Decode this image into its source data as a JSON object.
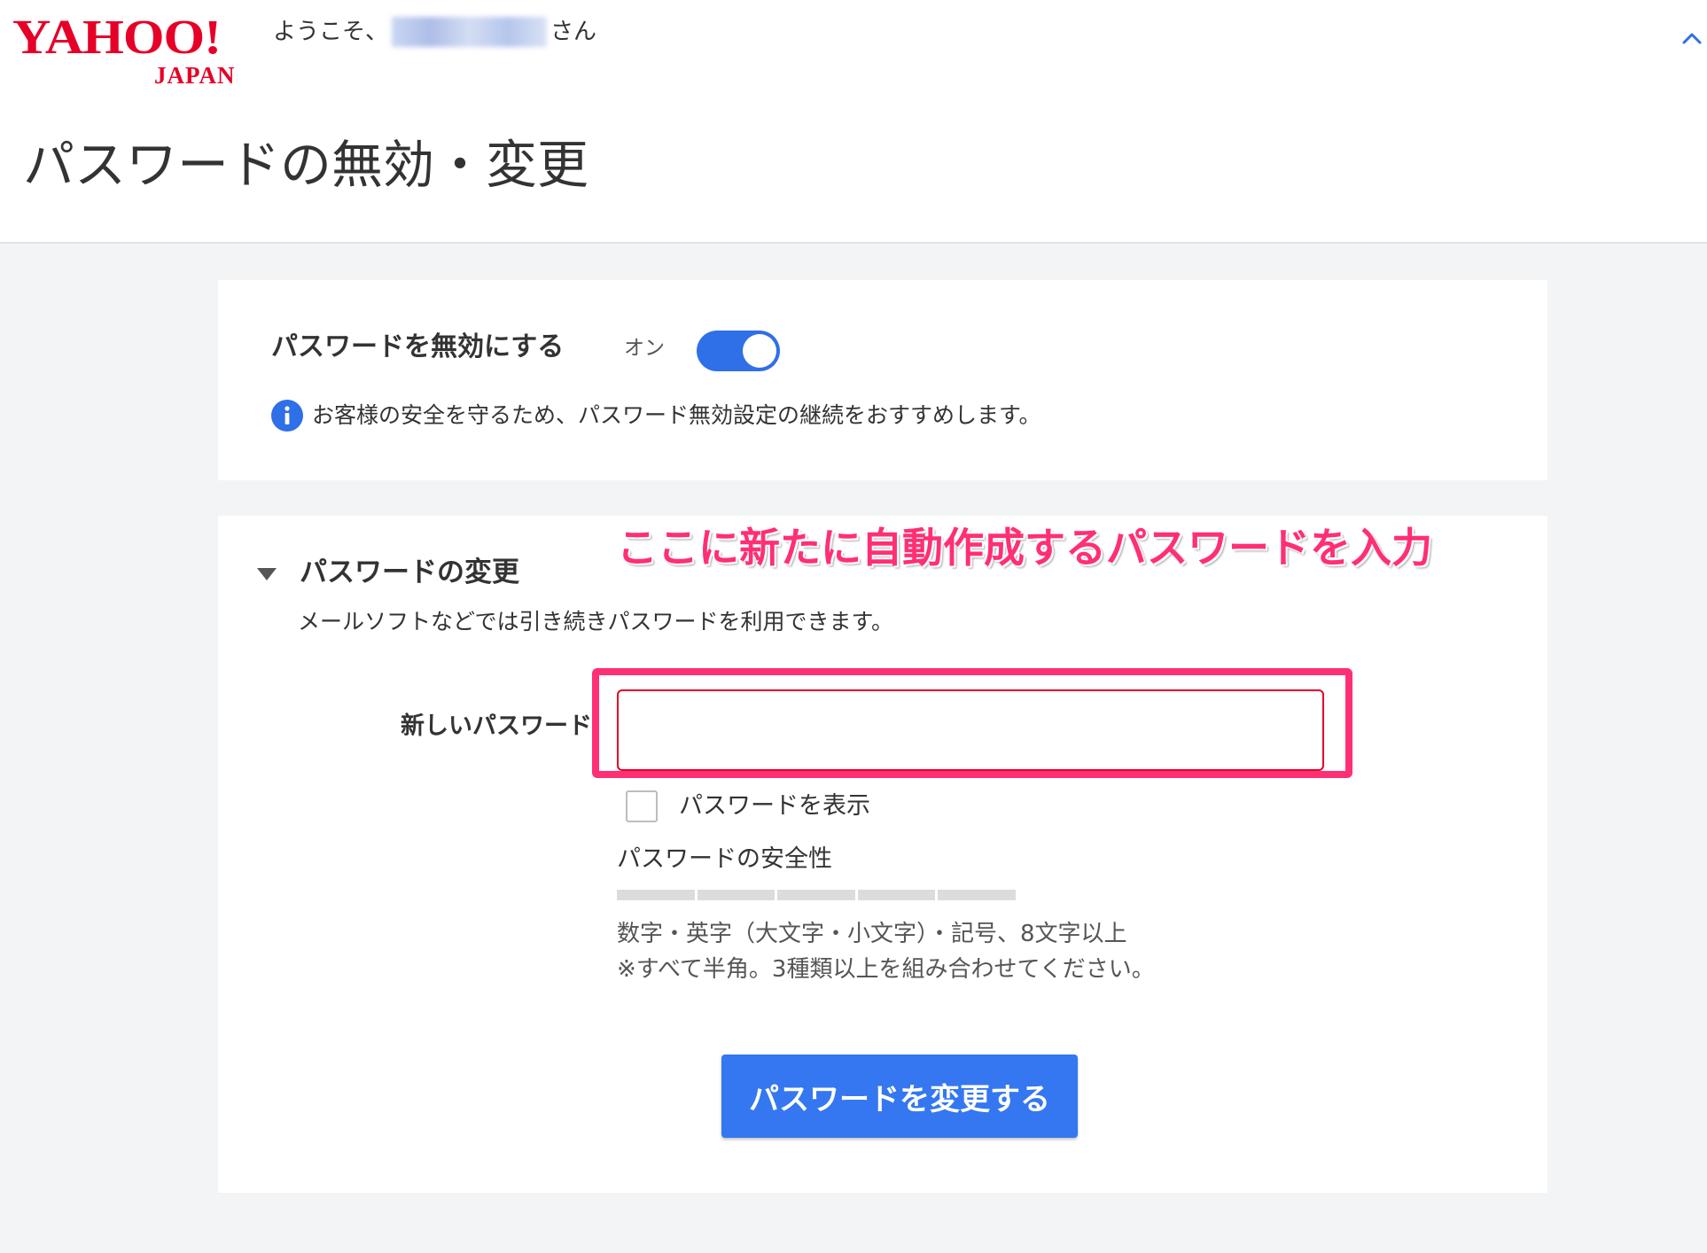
{
  "header": {
    "logo_word": "YAHOO!",
    "logo_sub": "JAPAN",
    "welcome_prefix": "ようこそ、",
    "welcome_suffix": "さん",
    "collapse_icon": "chevron-up-icon"
  },
  "page": {
    "title": "パスワードの無効・変更"
  },
  "disable_section": {
    "label": "パスワードを無効にする",
    "toggle_state": "オン",
    "toggle_on": true,
    "info_icon": "info-icon",
    "info_text": "お客様の安全を守るため、パスワード無効設定の継続をおすすめします。"
  },
  "change_section": {
    "annotation": "ここに新たに自動作成するパスワードを入力",
    "title": "パスワードの変更",
    "description": "メールソフトなどでは引き続きパスワードを利用できます。",
    "new_password_label": "新しいパスワード",
    "new_password_value": "",
    "show_password_label": "パスワードを表示",
    "show_password_checked": false,
    "strength_label": "パスワードの安全性",
    "strength_level": 0,
    "hint_line1": "数字・英字（大文字・小文字）・記号、8文字以上",
    "hint_line2": "※すべて半角。3種類以上を組み合わせてください。",
    "submit_label": "パスワードを変更する"
  },
  "colors": {
    "brand_red": "#e60027",
    "accent_blue": "#3477f0",
    "annotation_pink": "#ff2f73",
    "background": "#f3f4f6"
  }
}
